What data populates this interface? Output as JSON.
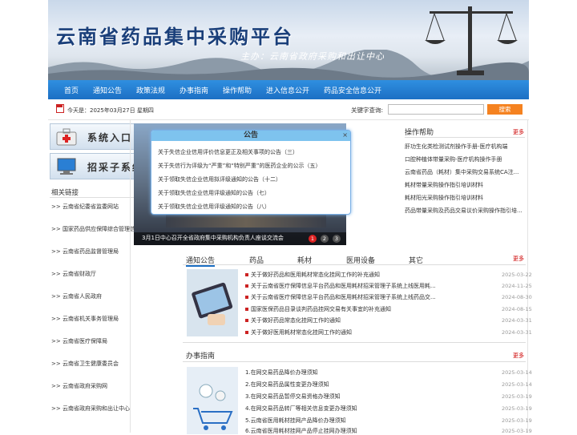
{
  "banner": {
    "title": "云南省药品集中采购平台",
    "subtitle": "主办：云南省政府采购和出让中心"
  },
  "nav": [
    "首页",
    "通知公告",
    "政策法规",
    "办事指南",
    "操作帮助",
    "进入信息公开",
    "药品安全信息公开"
  ],
  "datebar": {
    "date": "今天是：2025年03月27日 星期四",
    "keyword_label": "关键字查询:",
    "keyword_value": "",
    "search": "搜索"
  },
  "left": {
    "entry1": "系统入口",
    "entry2": "招采子系统",
    "links_title": "相关链接",
    "links": [
      ">> 云南省纪委省监委网站",
      ">> 国家药品供应保障综合管理信息平台",
      ">> 云南省药品监督管理局",
      ">> 云南省财政厅",
      ">> 云南省人民政府",
      ">> 云南省机关事务管理局",
      ">> 云南省医疗保障局",
      ">> 云南省卫生健康委员会",
      ">> 云南省政府采购网",
      ">> 云南省政府采购和出让中心"
    ]
  },
  "slider": {
    "caption": "3月1日中心召开全省政府集中采购机构负责人座谈交流会",
    "dots": [
      "1",
      "2",
      "3"
    ]
  },
  "popup": {
    "title": "公告",
    "close": "×",
    "items": [
      "关于失信企业信用评价信息更正及相关事项的公告（三）",
      "关于失信行为评级为“严重”和“特别严重”的医药企业的公示（五）",
      "关于领取失信企业信用拟评级通知的公告（十二）",
      "关于领取失信企业信用评级通知的公告（七）",
      "关于领取失信企业信用评级通知的公告（八）"
    ]
  },
  "help": {
    "title": "操作帮助",
    "more": "更多",
    "items": [
      "肝功生化类检测试剂操作手册-医疗机构端",
      "口腔种植体带量采购-医疗机构操作手册",
      "云南省药品（耗材）集中采购交易系统CA注...",
      "耗材带量采购操作指引培训材料",
      "耗材阳光采购操作指引培训材料",
      "药品带量采购及药品交易议价采购操作指引培..."
    ]
  },
  "notice": {
    "tabs": [
      "通知公告",
      "药品",
      "耗材",
      "医用设备",
      "其它"
    ],
    "more": "更多",
    "items": [
      {
        "t": "关于做好药品和医用耗材常态化挂网工作的补充通知",
        "d": "2025-03-22"
      },
      {
        "t": "关于云南省医疗保障信息平台药品和医用耗材招采管理子系统上线医用耗...",
        "d": "2024-11-25"
      },
      {
        "t": "关于云南省医疗保障信息平台药品和医用耗材招采管理子系统上线药品交...",
        "d": "2024-08-30"
      },
      {
        "t": "国家医保药品目录谈判药品挂网交易有关事宜的补充通知",
        "d": "2024-08-15"
      },
      {
        "t": "关于做好药品常态化挂网工作的通知",
        "d": "2024-03-31"
      },
      {
        "t": "关于做好医用耗材常态化挂网工作的通知",
        "d": "2024-03-31"
      }
    ]
  },
  "guide": {
    "title": "办事指南",
    "more": "更多",
    "items": [
      {
        "t": "1.在网交易药品降价办理须知",
        "d": "2025-03-14"
      },
      {
        "t": "2.在网交易药品属性变更办理须知",
        "d": "2025-03-14"
      },
      {
        "t": "3.在网交易药品暂停交易资格办理须知",
        "d": "2025-03-19"
      },
      {
        "t": "4.在网交易药品转厂等相关信息变更办理须知",
        "d": "2025-03-19"
      },
      {
        "t": "5.云南省医用耗材挂网产品降价办理须知",
        "d": "2025-03-19"
      },
      {
        "t": "6.云南省医用耗材挂网产品停止挂网办理须知",
        "d": "2025-03-19"
      }
    ]
  }
}
